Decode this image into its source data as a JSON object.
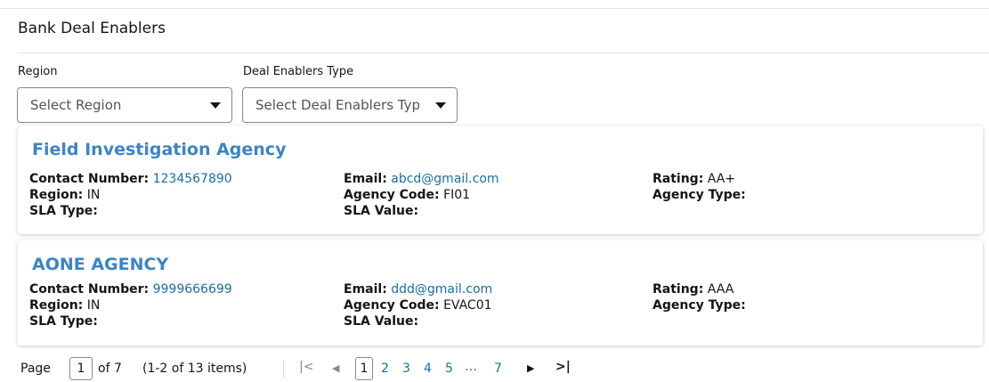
{
  "section_title": "Bank Deal Enablers",
  "filters": {
    "region": {
      "label": "Region",
      "placeholder": "Select Region"
    },
    "deal_type": {
      "label": "Deal Enablers Type",
      "placeholder": "Select Deal Enablers Typ"
    }
  },
  "field_labels": {
    "contact": "Contact Number:",
    "region": "Region:",
    "sla_type": "SLA Type:",
    "email": "Email:",
    "agency_code": "Agency Code:",
    "sla_value": "SLA Value:",
    "rating": "Rating:",
    "agency_type": "Agency Type:"
  },
  "agencies": [
    {
      "name": "Field Investigation Agency",
      "contact_number": "1234567890",
      "region": "IN",
      "sla_type": "",
      "email": "abcd@gmail.com",
      "agency_code": "FI01",
      "sla_value": "",
      "rating": "AA+",
      "agency_type": ""
    },
    {
      "name": "AONE AGENCY",
      "contact_number": "9999666699",
      "region": "IN",
      "sla_type": "",
      "email": "ddd@gmail.com",
      "agency_code": "EVAC01",
      "sla_value": "",
      "rating": "AAA",
      "agency_type": ""
    }
  ],
  "pagination": {
    "page_label": "Page",
    "current_page": "1",
    "of_label": "of 7",
    "items_summary": "(1-2 of 13 items)",
    "pages": [
      "1",
      "2",
      "3",
      "4",
      "5"
    ],
    "ellipsis": "…",
    "last_page": "7",
    "first_icon": "first-page-icon",
    "prev_icon": "previous-page-icon",
    "next_icon": "next-page-icon",
    "last_icon": "last-page-icon"
  },
  "colors": {
    "agency_name": "#3d84c4",
    "link_value": "#1a6fa1",
    "text": "#161513"
  }
}
